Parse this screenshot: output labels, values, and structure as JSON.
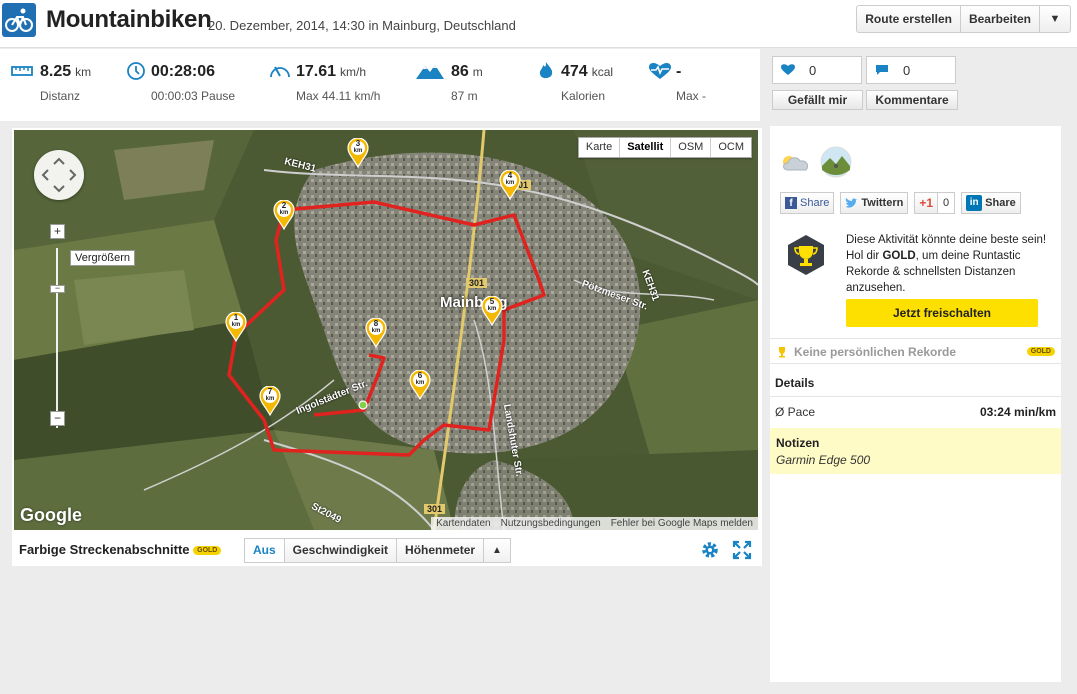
{
  "header": {
    "title": "Mountainbiken",
    "subtitle": "20. Dezember, 2014, 14:30 in Mainburg, Deutschland",
    "buttons": [
      "Route erstellen",
      "Bearbeiten"
    ],
    "dropdown_icon": "caret-down-icon"
  },
  "stats": [
    {
      "icon": "ruler-icon",
      "value": "8.25",
      "unit": "km",
      "sub": "Distanz"
    },
    {
      "icon": "clock-icon",
      "value": "00:28:06",
      "unit": "",
      "sub": "00:00:03 Pause"
    },
    {
      "icon": "speedometer-icon",
      "value": "17.61",
      "unit": "km/h",
      "sub": "Max 44.11 km/h"
    },
    {
      "icon": "mountain-icon",
      "value": "86",
      "unit": "m",
      "sub": "87 m"
    },
    {
      "icon": "flame-icon",
      "value": "474",
      "unit": "kcal",
      "sub": "Kalorien"
    },
    {
      "icon": "heart-rate-icon",
      "value": "-",
      "unit": "",
      "sub": "Max -"
    }
  ],
  "social": {
    "likes": "0",
    "comments": "0",
    "like_label": "Gefällt mir",
    "comment_label": "Kommentare"
  },
  "map": {
    "types": [
      "Karte",
      "Satellit",
      "OSM",
      "OCM"
    ],
    "active_type": "Satellit",
    "zoom_tooltip": "Vergrößern",
    "zoom_in": "+",
    "zoom_out": "−",
    "logo": "Google",
    "attributions": [
      "Kartendaten",
      "Nutzungsbedingungen",
      "Fehler bei Google Maps melden"
    ],
    "labels": {
      "town": "Mainburg",
      "roads": [
        "KEH31",
        "301",
        "301",
        "301",
        "KEH31",
        "Pötzmeser Str.",
        "Ingolstädter Str.",
        "Landshuter Str.",
        "St2049"
      ]
    },
    "km_markers": [
      "1",
      "2",
      "3",
      "4",
      "5",
      "6",
      "7",
      "8"
    ],
    "km_unit": "km",
    "route_color": "#e0231f",
    "marker_color": "#f5b800"
  },
  "map_footer": {
    "title": "Farbige Streckenabschnitte",
    "gold_badge": "GOLD",
    "tabs": [
      "Aus",
      "Geschwindigkeit",
      "Höhenmeter"
    ],
    "active_tab": "Aus",
    "toggle_icon": "triangle-up-icon"
  },
  "share": {
    "facebook": "Share",
    "twitter": "Twittern",
    "gplus": "+1",
    "gplus_count": "0",
    "linkedin": "Share"
  },
  "promo": {
    "text_before": "Diese Aktivität könnte deine beste sein! Hol dir ",
    "text_bold": "GOLD",
    "text_after": ", um deine Runtastic Rekorde & schnellsten Distanzen anzusehen.",
    "button": "Jetzt freischalten"
  },
  "records": {
    "label": "Keine persönlichen Rekorde",
    "badge": "GOLD"
  },
  "details": {
    "title": "Details",
    "pace_label": "Ø Pace",
    "pace_value": "03:24 min/km"
  },
  "notes": {
    "title": "Notizen",
    "text": "Garmin Edge 500"
  },
  "colors": {
    "accent": "#1a83c4",
    "gold": "#fde000"
  }
}
